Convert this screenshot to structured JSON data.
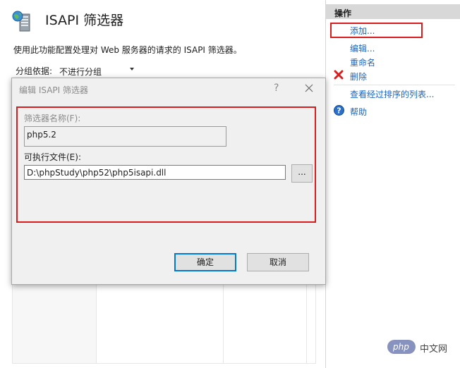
{
  "header": {
    "title": "ISAPI 筛选器",
    "description": "使用此功能配置处理对 Web 服务器的请求的 ISAPI 筛选器。",
    "icon": "server-globe-icon"
  },
  "groupbar": {
    "label": "分组依据:",
    "selected": "不进行分组"
  },
  "actions": {
    "header": "操作",
    "add": "添加...",
    "edit": "编辑...",
    "rename": "重命名",
    "delete": "删除",
    "view_sorted": "查看经过排序的列表...",
    "help": "帮助"
  },
  "dialog": {
    "title": "编辑 ISAPI 筛选器",
    "help_glyph": "?",
    "name_label": "筛选器名称(F):",
    "name_value": "php5.2",
    "exe_label": "可执行文件(E):",
    "exe_value": "D:\\phpStudy\\php52\\php5isapi.dll",
    "browse_label": "...",
    "ok_label": "确定",
    "cancel_label": "取消"
  },
  "watermark": {
    "badge": "php",
    "text": "中文网"
  },
  "colors": {
    "link": "#1b64c2",
    "highlight": "#d91c1c",
    "default_button_border": "#0078d7",
    "actions_header_bg": "#d8d8d8"
  }
}
